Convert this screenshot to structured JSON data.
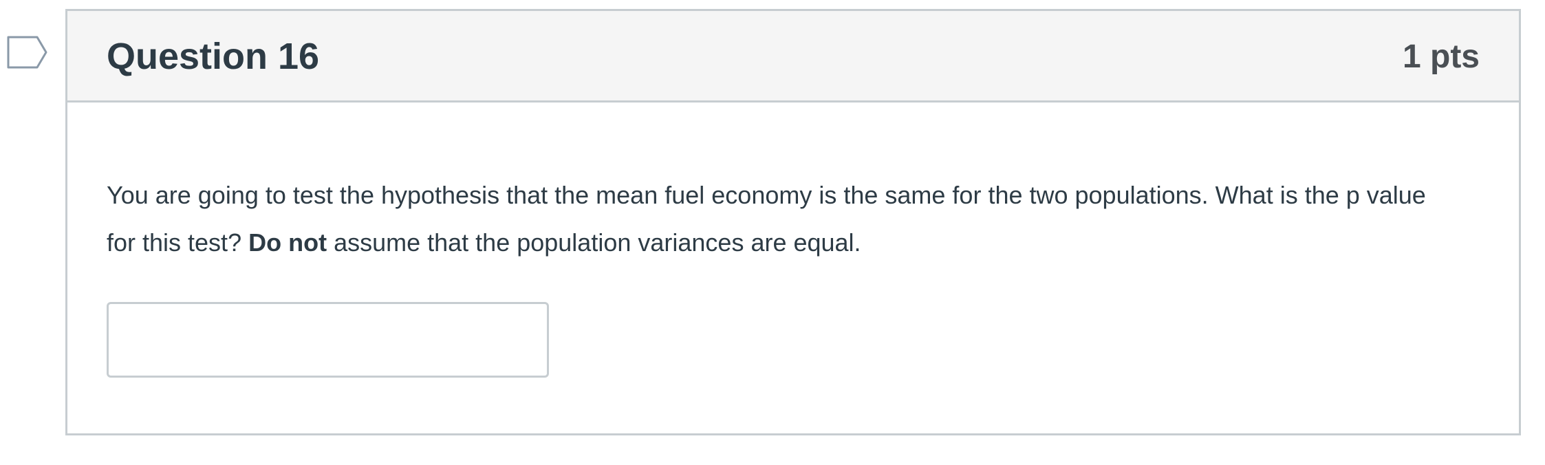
{
  "flag": {
    "icon": "bookmark-flag-icon"
  },
  "question": {
    "title": "Question 16",
    "points": "1 pts",
    "text_part1": "You are going to test the hypothesis that the mean fuel economy is the same for the two populations.  What is the p value for this test?  ",
    "text_bold": "Do not",
    "text_part2": " assume that the population variances are equal.",
    "answer_value": ""
  },
  "colors": {
    "text": "#2d3b45",
    "border": "#c7cdd1",
    "header_bg": "#f5f5f5",
    "points_text": "#4a4f54",
    "flag_stroke": "#8a99a8"
  }
}
